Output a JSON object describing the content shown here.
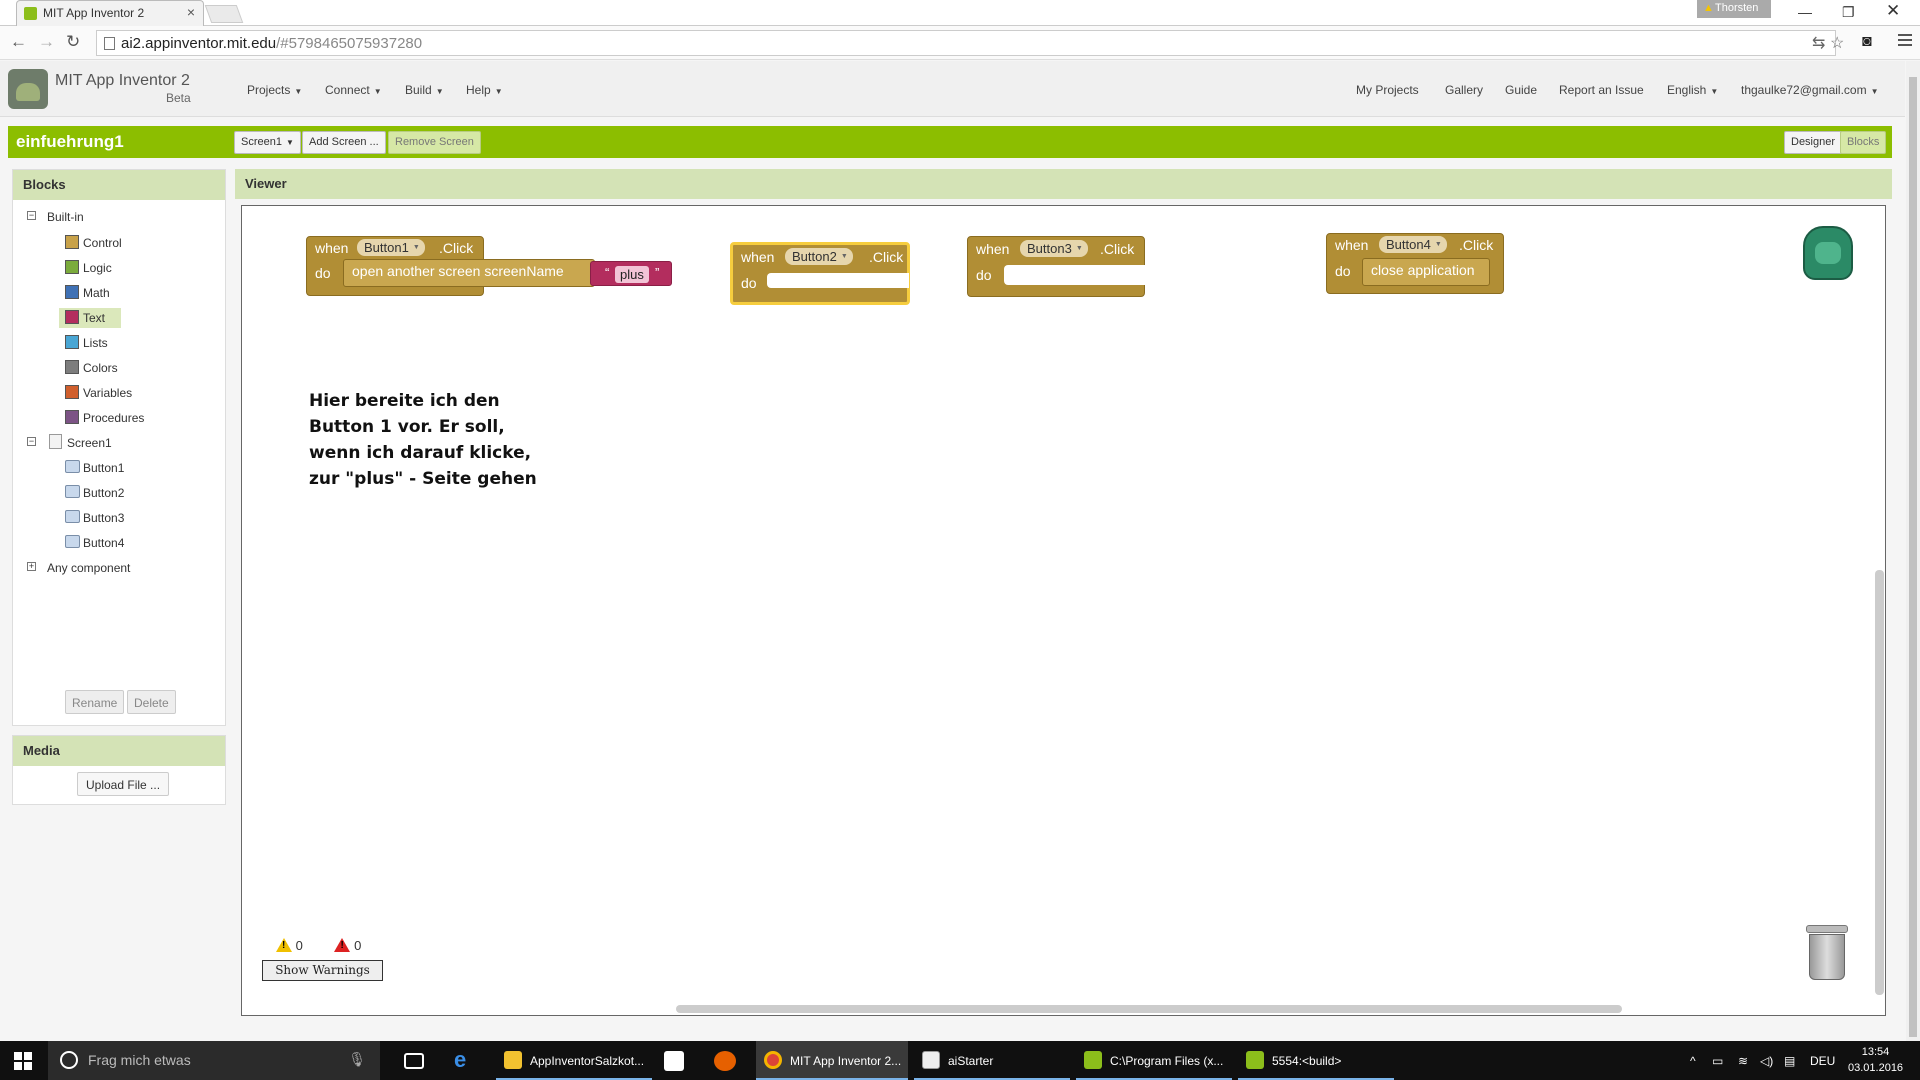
{
  "browser": {
    "tab_title": "MIT App Inventor 2",
    "tab_close": "×",
    "user_name": "Thorsten",
    "url_host": "ai2.appinventor.mit.edu",
    "url_path": "/#5798465075937280"
  },
  "header": {
    "brand": "MIT App Inventor 2",
    "brand_sub": "Beta",
    "menu": [
      "Projects",
      "Connect",
      "Build",
      "Help"
    ],
    "right_links": [
      "My Projects",
      "Gallery",
      "Guide",
      "Report an Issue",
      "English",
      "thgaulke72@gmail.com"
    ]
  },
  "project_bar": {
    "project_name": "einfuehrung1",
    "screen_select": "Screen1",
    "add_screen": "Add Screen ...",
    "remove_screen": "Remove Screen",
    "designer": "Designer",
    "blocks": "Blocks"
  },
  "blocks_panel": {
    "title": "Blocks",
    "builtin_label": "Built-in",
    "builtin": [
      {
        "label": "Control",
        "color": "#c8a24a"
      },
      {
        "label": "Logic",
        "color": "#7bab3c"
      },
      {
        "label": "Math",
        "color": "#3f71b5"
      },
      {
        "label": "Text",
        "color": "#b32d5e"
      },
      {
        "label": "Lists",
        "color": "#49a6d4"
      },
      {
        "label": "Colors",
        "color": "#7d7d7d"
      },
      {
        "label": "Variables",
        "color": "#d05f2d"
      },
      {
        "label": "Procedures",
        "color": "#7c5385"
      }
    ],
    "selected": "Text",
    "screen_label": "Screen1",
    "components": [
      "Button1",
      "Button2",
      "Button3",
      "Button4"
    ],
    "any_component": "Any component",
    "rename": "Rename",
    "delete": "Delete"
  },
  "media_panel": {
    "title": "Media",
    "upload": "Upload File ..."
  },
  "viewer": {
    "title": "Viewer",
    "blocks": [
      {
        "when": "when",
        "component": "Button1",
        "event": ".Click",
        "do": "do",
        "statement": "open another screen  screenName",
        "text_value": "plus"
      },
      {
        "when": "when",
        "component": "Button2",
        "event": ".Click",
        "do": "do"
      },
      {
        "when": "when",
        "component": "Button3",
        "event": ".Click",
        "do": "do"
      },
      {
        "when": "when",
        "component": "Button4",
        "event": ".Click",
        "do": "do",
        "statement": "close application"
      }
    ],
    "quote_open": "“",
    "quote_close": "”",
    "comment_lines": [
      "Hier bereite ich den",
      "Button 1 vor. Er soll,",
      "wenn ich darauf klicke,",
      "zur \"plus\" - Seite gehen"
    ],
    "warnings_count": "0",
    "errors_count": "0",
    "show_warnings": "Show Warnings"
  },
  "taskbar": {
    "search_placeholder": "Frag mich etwas",
    "items": [
      "AppInventorSalzkot...",
      "MIT App Inventor 2...",
      "aiStarter",
      "C:\\Program Files (x...",
      "5554:<build>"
    ],
    "language": "DEU",
    "time": "13:54",
    "date": "03.01.2016"
  },
  "colors": {
    "accent_green": "#8cbe00",
    "panel_header": "#d4e3b6",
    "event_block": "#b18e35",
    "text_block": "#b32d5e"
  }
}
